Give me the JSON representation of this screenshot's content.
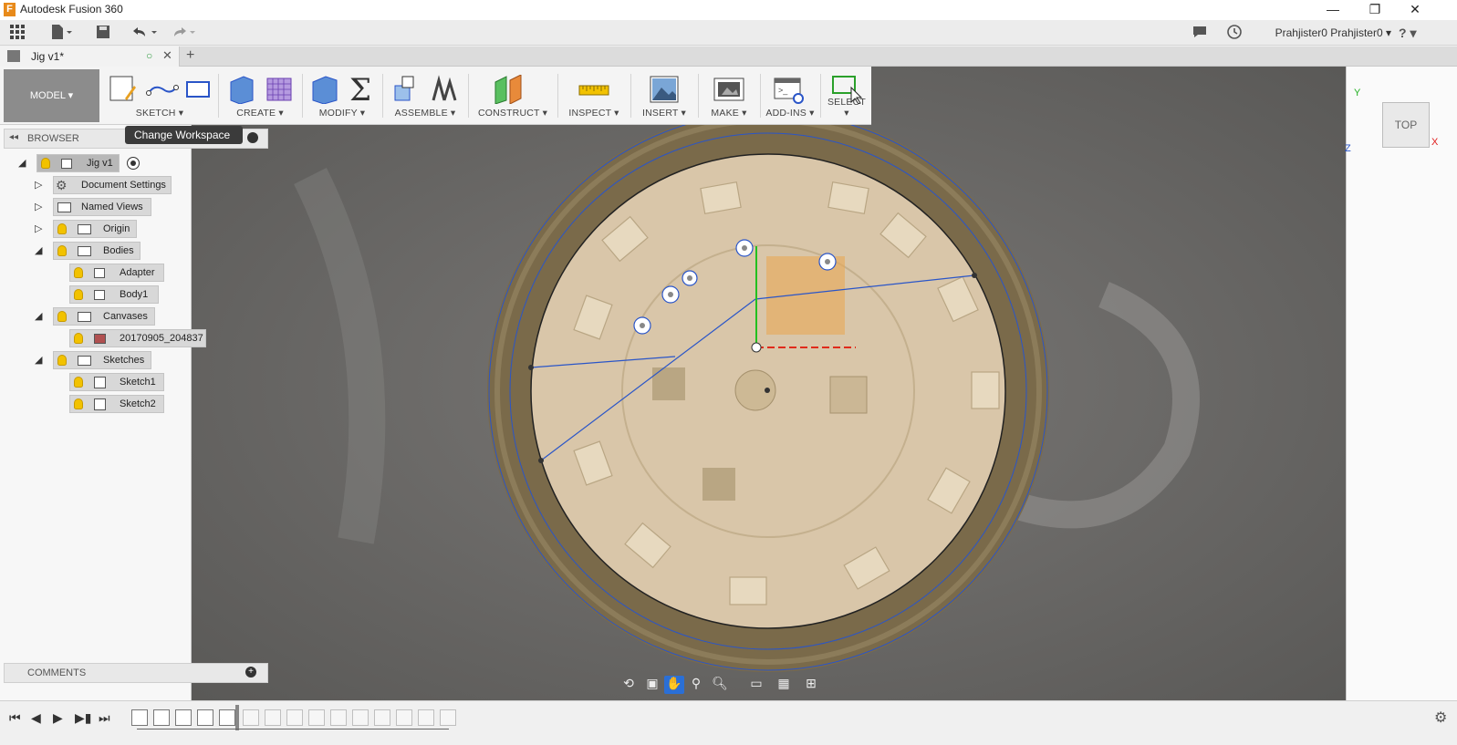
{
  "app": {
    "title": "Autodesk Fusion 360",
    "logo_letter": "F"
  },
  "window": {
    "minimize": "—",
    "restore": "❐",
    "close": "✕"
  },
  "quickbar": {
    "user": "Prahjister0 Prahjister0 ▾",
    "help": "? ▾"
  },
  "doc_tab": {
    "name": "Jig v1*",
    "new_tab": "+"
  },
  "toolbar": {
    "workspace": "MODEL ▾",
    "groups": [
      "SKETCH ▾",
      "CREATE ▾",
      "MODIFY ▾",
      "ASSEMBLE ▾",
      "CONSTRUCT ▾",
      "INSPECT ▾",
      "INSERT ▾",
      "MAKE ▾",
      "ADD-INS ▾",
      "SELECT ▾"
    ]
  },
  "tooltip": "Change Workspace",
  "browser": {
    "title": "BROWSER",
    "root": "Jig v1",
    "items": [
      {
        "label": "Document Settings"
      },
      {
        "label": "Named Views"
      },
      {
        "label": "Origin"
      },
      {
        "label": "Bodies"
      },
      {
        "label": "Adapter"
      },
      {
        "label": "Body1"
      },
      {
        "label": "Canvases"
      },
      {
        "label": "20170905_204837"
      },
      {
        "label": "Sketches"
      },
      {
        "label": "Sketch1"
      },
      {
        "label": "Sketch2"
      }
    ]
  },
  "comments": {
    "title": "COMMENTS"
  },
  "viewcube": {
    "face": "TOP",
    "axis_x": "X",
    "axis_y": "Y",
    "axis_z": "Z"
  },
  "colors": {
    "accent": "#2a6fd6",
    "ring": "#7a6a4a",
    "pcb": "#d9c6a9"
  }
}
